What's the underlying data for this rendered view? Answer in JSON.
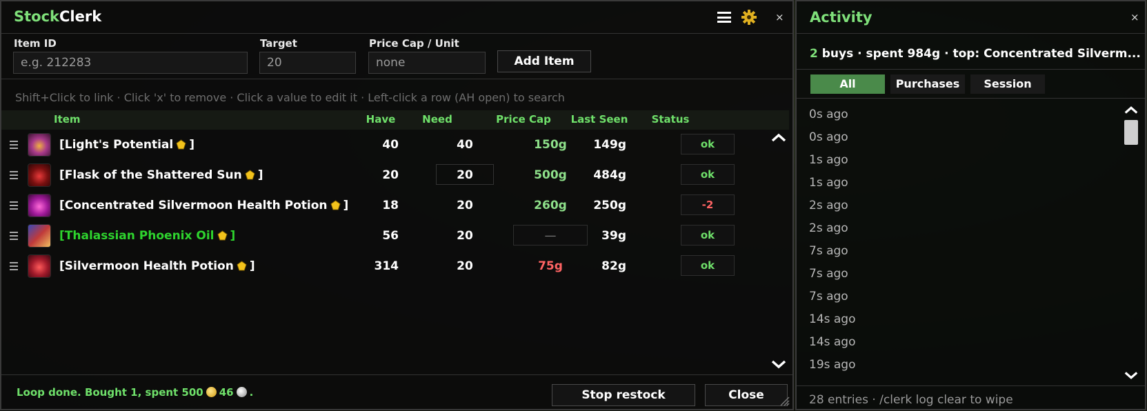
{
  "main": {
    "title_part1": "Stock",
    "title_part2": "Clerk",
    "close": "×",
    "form": {
      "item_id_label": "Item ID",
      "item_id_placeholder": "e.g. 212283",
      "target_label": "Target",
      "target_value": "20",
      "price_cap_label": "Price Cap / Unit",
      "price_cap_value": "none",
      "add_button": "Add Item"
    },
    "hint": "Shift+Click to link · Click 'x' to remove · Click a value to edit it · Left-click a row (AH open) to search",
    "columns": {
      "item": "Item",
      "have": "Have",
      "need": "Need",
      "price_cap": "Price Cap",
      "last_seen": "Last Seen",
      "status": "Status"
    },
    "rows": [
      {
        "name": "[Light's Potential",
        "close_bracket": "]",
        "have": "40",
        "need": "40",
        "price_cap": "150g",
        "last_seen": "149g",
        "status": "ok"
      },
      {
        "name": "[Flask of the Shattered Sun",
        "close_bracket": "]",
        "have": "20",
        "need": "20",
        "price_cap": "500g",
        "last_seen": "484g",
        "status": "ok"
      },
      {
        "name": "[Concentrated Silvermoon Health Potion",
        "close_bracket": "]",
        "have": "18",
        "need": "20",
        "price_cap": "260g",
        "last_seen": "250g",
        "status": "-2"
      },
      {
        "name": "[Thalassian Phoenix Oil",
        "close_bracket": "]",
        "have": "56",
        "need": "20",
        "price_cap": "—",
        "last_seen": "39g",
        "status": "ok"
      },
      {
        "name": "[Silvermoon Health Potion",
        "close_bracket": "]",
        "have": "314",
        "need": "20",
        "price_cap": "75g",
        "last_seen": "82g",
        "status": "ok"
      }
    ],
    "footer": {
      "message_prefix": "Loop done. Bought 1, spent 500",
      "silver": "46",
      "message_suffix": ".",
      "stop_button": "Stop restock",
      "close_button": "Close"
    }
  },
  "activity": {
    "title": "Activity",
    "close": "×",
    "summary_count": "2",
    "summary_text": "buys · spent 984g  ·  top: Concentrated Silverm...",
    "tabs": [
      "All",
      "Purchases",
      "Session"
    ],
    "active_tab": "All",
    "log": [
      "0s ago",
      "0s ago",
      "1s ago",
      "1s ago",
      "2s ago",
      "2s ago",
      "7s ago",
      "7s ago",
      "7s ago",
      "14s ago",
      "14s ago",
      "19s ago"
    ],
    "footer": "28 entries · /clerk log clear to wipe"
  },
  "colors": {
    "accent_green": "#7fe07a",
    "ok_green": "#6fe06a",
    "warn_red": "#ff6464",
    "cap_green": "#8ee08a"
  },
  "icons": [
    "menu-icon",
    "gear-icon",
    "close-icon",
    "drag-handle-icon",
    "gem-icon",
    "gold-coin-icon",
    "silver-coin-icon",
    "chevron-up-icon",
    "chevron-down-icon",
    "resize-grip-icon"
  ]
}
